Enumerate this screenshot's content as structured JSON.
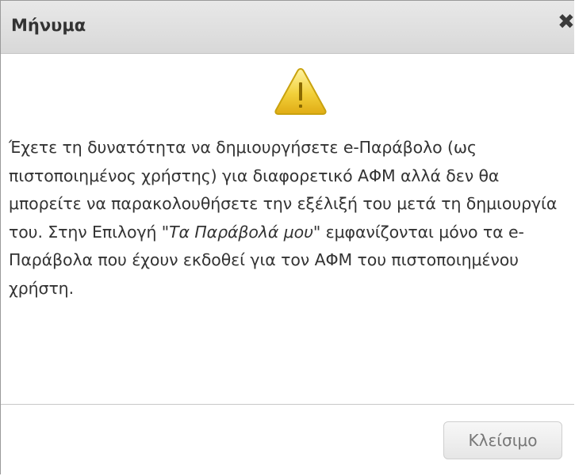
{
  "dialog": {
    "title": "Μήνυμα",
    "close_glyph": "✖",
    "icon": "warning-icon",
    "message": {
      "part1": "Έχετε τη δυνατότητα να δημιουργήσετε e-Παράβολο (ως πιστοποιημένος χρήστης) για διαφορετικό ΑΦΜ αλλά δεν θα μπορείτε να παρακολουθήσετε την εξέλιξή του μετά τη δημιουργία του. Στην Επιλογή ",
      "emphasis": "\"Τα Παράβολά μου\"",
      "part2": " εμφανίζονται μόνο τα e-Παράβολα που έχουν εκδοθεί για τον ΑΦΜ του πιστοποιημένου χρήστη."
    },
    "button_label": "Κλείσιμο"
  },
  "colors": {
    "titlebar": "#dcdcdc",
    "text": "#333333",
    "warning_fill": "#f2d03a",
    "warning_stroke": "#c9a20f",
    "button_text": "#777777"
  }
}
